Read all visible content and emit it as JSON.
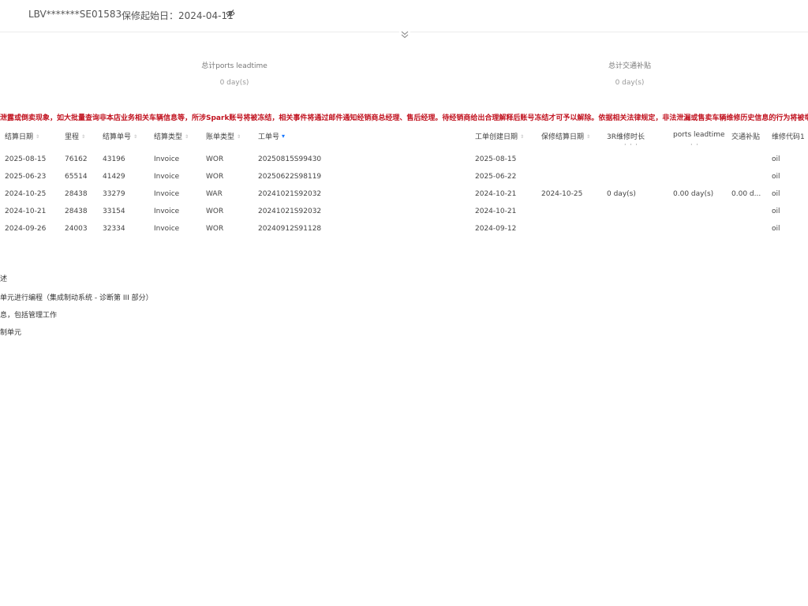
{
  "header": {
    "vin": "LBV*******SE01583",
    "warranty_start_label": "保修起始日：",
    "warranty_start_date": "2024-04-11"
  },
  "summary": [
    {
      "label": "总计ports leadtime",
      "value": "0 day(s)"
    },
    {
      "label": "总计交通补贴",
      "value": "0 day(s)"
    }
  ],
  "warning_text": "泄露或倒卖现象，如大批量查询非本店业务相关车辆信息等，所涉Spark账号将被冻结，相关事件将通过邮件通知经销商总经理、售后经理。待经销商给出合理解释后账号冻结才可予以解除。依据相关法律规定，非法泄漏或售卖车辆维修历史信息的行为将被举报至公安",
  "table": {
    "columns": [
      "结算日期",
      "里程",
      "结算单号",
      "结算类型",
      "账单类型",
      "工单号",
      "工单创建日期",
      "保修结算日期",
      "3R维修时长",
      "ports leadtime",
      "交通补贴",
      "维修代码1"
    ],
    "column_subtext": {
      "3R维修时长": "· · ·",
      "ports leadtime": "· ·"
    },
    "sorted_column": "工单号",
    "rows": [
      [
        "2025-08-15",
        "76162",
        "43196",
        "Invoice",
        "WOR",
        "20250815S99430",
        "2025-08-15",
        "",
        "",
        "",
        "",
        "oil"
      ],
      [
        "2025-06-23",
        "65514",
        "41429",
        "Invoice",
        "WOR",
        "20250622S98119",
        "2025-06-22",
        "",
        "",
        "",
        "",
        "oil"
      ],
      [
        "2024-10-25",
        "28438",
        "33279",
        "Invoice",
        "WAR",
        "20241021S92032",
        "2024-10-21",
        "2024-10-25",
        "0 day(s)",
        "0.00 day(s)",
        "0.00 d...",
        "oil"
      ],
      [
        "2024-10-21",
        "28438",
        "33154",
        "Invoice",
        "WOR",
        "20241021S92032",
        "2024-10-21",
        "",
        "",
        "",
        "",
        "oil"
      ],
      [
        "2024-09-26",
        "24003",
        "32334",
        "Invoice",
        "WOR",
        "20240912S91128",
        "2024-09-12",
        "",
        "",
        "",
        "",
        "oil"
      ]
    ]
  },
  "descriptions": [
    "述",
    "单元进行编程（集成制动系统 - 诊断第 III 部分）",
    "息，包括管理工作",
    "制单元"
  ]
}
